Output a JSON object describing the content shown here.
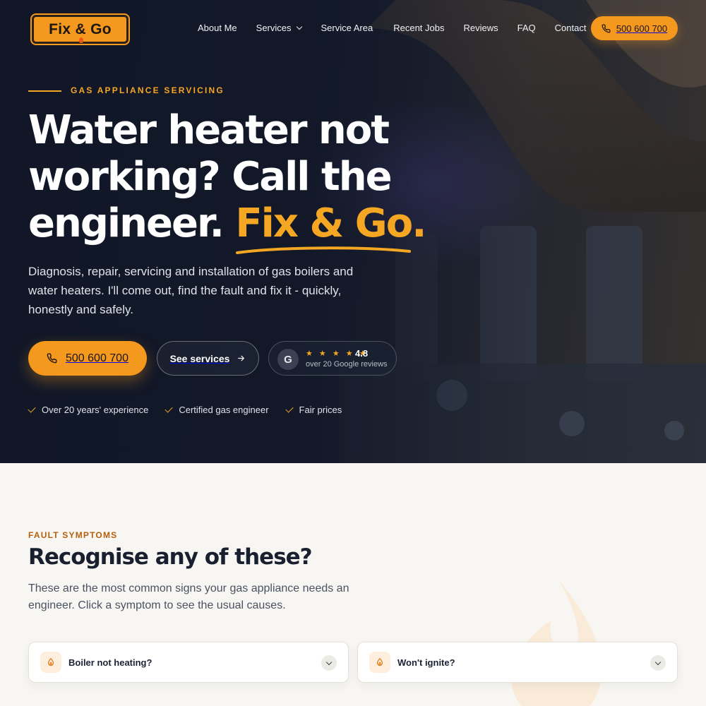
{
  "brand": {
    "logo_text": "Fix & Go",
    "accent": "#f5981e",
    "dark": "#131a2b"
  },
  "nav": {
    "items": [
      {
        "label": "About Me",
        "has_dropdown": false
      },
      {
        "label": "Services",
        "has_dropdown": true
      },
      {
        "label": "Service Area",
        "has_dropdown": false
      },
      {
        "label": "Recent Jobs",
        "has_dropdown": false
      },
      {
        "label": "Reviews",
        "has_dropdown": false
      },
      {
        "label": "FAQ",
        "has_dropdown": false
      },
      {
        "label": "Contact",
        "has_dropdown": false
      }
    ],
    "phone_button": {
      "label": "500 600 700",
      "icon": "phone-icon"
    }
  },
  "hero": {
    "kicker": "GAS APPLIANCE SERVICING",
    "headline_line1": "Water heater not",
    "headline_line2": "working? Call the",
    "headline_line3_plain": "engineer.",
    "headline_line3_accent": "Fix & Go.",
    "lede": "Diagnosis, repair, servicing and installation of gas boilers and water heaters. I'll come out, find the fault and fix it - quickly, honestly and safely.",
    "cta_call": {
      "label": "500 600 700",
      "icon": "phone-icon"
    },
    "cta_services": {
      "label": "See services",
      "icon": "arrow-right-icon"
    },
    "reviews": {
      "badge": "G",
      "stars": "★ ★ ★ ★ ★",
      "rating": "4.8",
      "subtitle": "over 20 Google reviews"
    },
    "features": [
      "Over 20 years' experience",
      "Certified gas engineer",
      "Fair prices"
    ]
  },
  "symptoms": {
    "kicker": "FAULT SYMPTOMS",
    "title": "Recognise any of these?",
    "description": "These are the most common signs your gas appliance needs an engineer. Click a symptom to see the usual causes.",
    "cards": [
      {
        "label": "Boiler not heating?",
        "icon": "flame-icon"
      },
      {
        "label": "Won't ignite?",
        "icon": "flame-icon"
      }
    ]
  }
}
